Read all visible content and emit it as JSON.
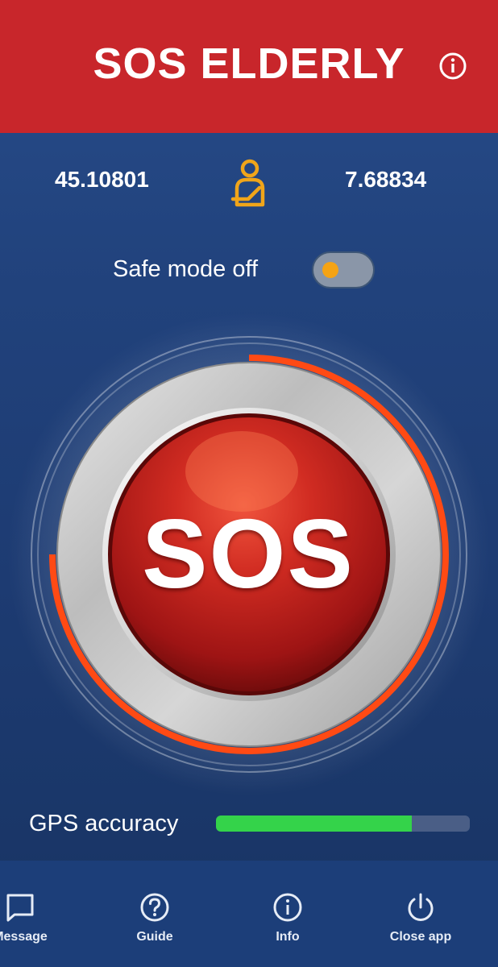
{
  "header": {
    "title": "SOS ELDERLY",
    "info_icon": "info-icon"
  },
  "location": {
    "latitude": "45.10801",
    "longitude": "7.68834",
    "person_icon": "elderly-person-icon",
    "person_icon_color": "#f0a51a"
  },
  "safe_mode": {
    "label": "Safe mode off",
    "enabled": false,
    "knob_color": "#f5a314"
  },
  "sos": {
    "label": "SOS",
    "button_color": "#c8262b",
    "ring_progress_color": "#ff4a14"
  },
  "gps": {
    "label": "GPS accuracy",
    "accuracy": 0.77,
    "bar_color": "#34d34a"
  },
  "nav": {
    "items": [
      {
        "label": "Message",
        "icon": "message-icon"
      },
      {
        "label": "Guide",
        "icon": "help-icon"
      },
      {
        "label": "Info",
        "icon": "info-icon"
      },
      {
        "label": "Close app",
        "icon": "power-icon"
      }
    ]
  },
  "colors": {
    "header_bg": "#c8262b",
    "background": "#21427c"
  }
}
